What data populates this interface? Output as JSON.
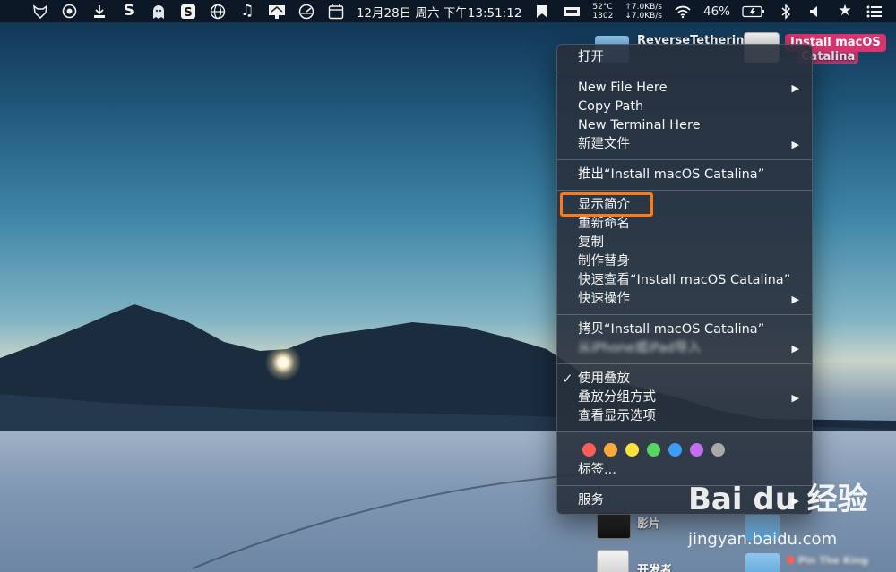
{
  "menubar": {
    "icons": [
      "fox-icon",
      "chrome-icon",
      "download-icon",
      "s-app-icon",
      "ghost-icon",
      "s-box-icon",
      "globe-icon",
      "music-note-icon",
      "display-icon",
      "speedometer-icon",
      "calendar-icon"
    ],
    "clock": "12月28日 周六 下午13:51:12",
    "bookmark_icon": "bookmark-icon",
    "battery_app_icon": "battery-monitor-icon",
    "temp": "52°C",
    "fan": "1302",
    "up_speed": "↑7.0KB/s",
    "down_speed": "↓7.0KB/s",
    "wifi_icon": "wifi-icon",
    "battery_percent": "46%",
    "battery_icon": "battery-charging-icon",
    "bluetooth_icon": "bluetooth-icon",
    "volume_icon": "volume-icon",
    "star_icon": "star-icon",
    "menu_icon": "list-icon"
  },
  "desktop": {
    "item1_label": "ReverseTetherin",
    "item2_label": "Install macOS",
    "item2_label_line2": "Catalina",
    "item3_label": "影片",
    "item4_label": "开发者",
    "item5_label": "Pin The King"
  },
  "context_menu": {
    "open": "打开",
    "new_file_here": "New File Here",
    "copy_path": "Copy Path",
    "new_terminal_here": "New Terminal Here",
    "new_file": "新建文件",
    "eject": "推出“Install macOS Catalina”",
    "get_info": "显示简介",
    "rename": "重新命名",
    "duplicate": "复制",
    "make_alias": "制作替身",
    "quick_look": "快速查看“Install macOS Catalina”",
    "quick_actions": "快速操作",
    "copy_item": "拷贝“Install macOS Catalina”",
    "import_from_iphone": "从iPhone或iPad导入",
    "use_stacks": "使用叠放",
    "group_stacks_by": "叠放分组方式",
    "show_view_options": "查看显示选项",
    "tags": "标签...",
    "services": "服务",
    "submenu_arrow": "▶",
    "checkmark": "✓"
  },
  "tag_colors": [
    "#fc5e57",
    "#fdaa3b",
    "#fde03c",
    "#58d462",
    "#3e9df7",
    "#c56df0",
    "#a9a9a9"
  ],
  "highlight_color": "#ff7a12",
  "watermark": {
    "logo": "Bai du 经验",
    "url": "jingyan.baidu.com"
  }
}
